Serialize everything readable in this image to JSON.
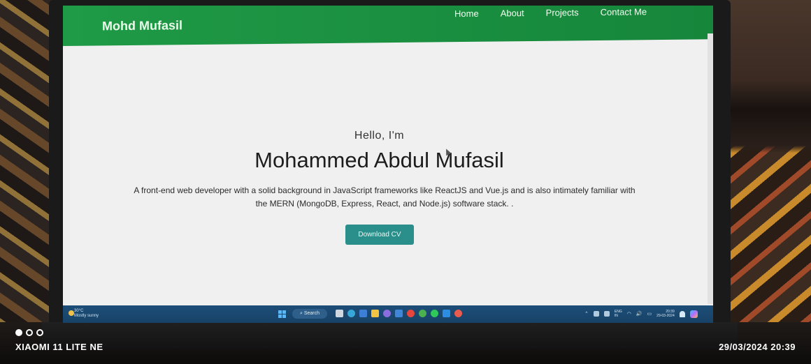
{
  "site": {
    "brand": "Mohd Mufasil",
    "nav": [
      {
        "label": "Home"
      },
      {
        "label": "About"
      },
      {
        "label": "Projects"
      },
      {
        "label": "Contact Me"
      }
    ],
    "accent_color": "#1f9a46"
  },
  "hero": {
    "greeting": "Hello, I'm",
    "name": "Mohammed Abdul Mufasil",
    "description_line1": "A front-end web developer with a solid background in JavaScript frameworks like ReactJS and Vue.js and is also intimately familiar with",
    "description_line2": "the MERN (MongoDB, Express, React, and Node.js) software stack. .",
    "cta_label": "Download CV",
    "cta_color": "#2a8f8a"
  },
  "taskbar": {
    "search_label": "Search",
    "weather_temp": "30°C",
    "weather_desc": "Mostly sunny",
    "tray_lang": "ENG",
    "tray_region": "IN",
    "clock_time": "20:39",
    "clock_date": "29-03-2024"
  },
  "photo_overlay": {
    "device": "XIAOMI 11 LITE NE",
    "timestamp": "29/03/2024  20:39"
  },
  "icons": [
    "windows-start-icon",
    "search-icon",
    "task-view-icon",
    "edge-icon",
    "file-explorer-icon",
    "store-icon",
    "chrome-icon",
    "whatsapp-icon",
    "vscode-icon",
    "wifi-icon",
    "volume-icon",
    "battery-icon",
    "bell-icon",
    "copilot-icon"
  ]
}
